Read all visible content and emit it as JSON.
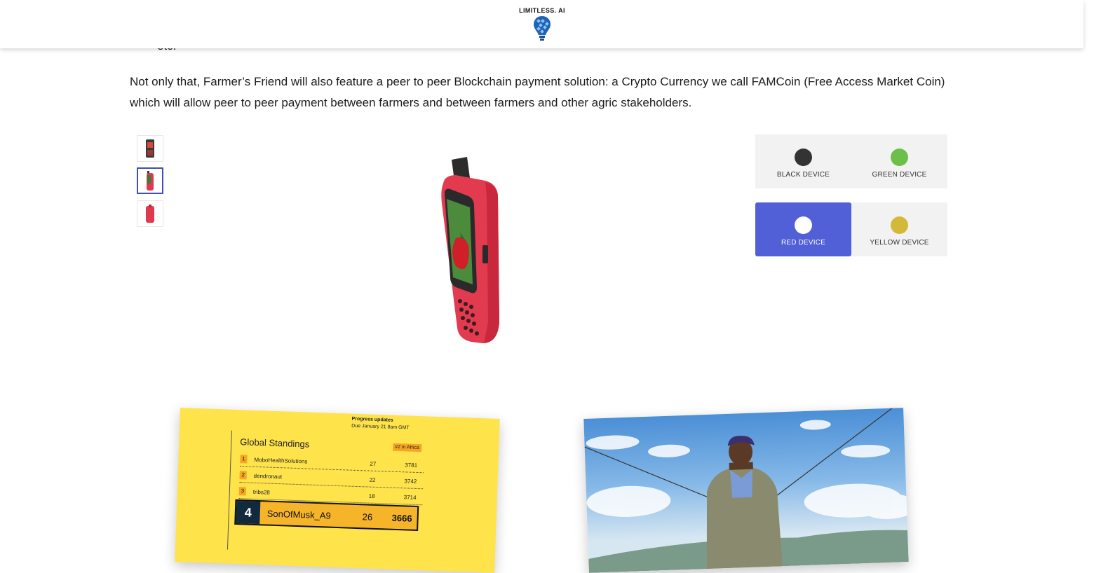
{
  "header": {
    "logo_text": "LIMITLESS. AI"
  },
  "content": {
    "bullet_item": "etc.",
    "paragraph": "Not only that, Farmer’s Friend will also feature a peer to peer Blockchain payment solution: a Crypto Currency we call FAMCoin (Free Access Market Coin) which will allow peer to peer payment between farmers and between farmers and other agric stakeholders."
  },
  "gallery": {
    "thumbnails": [
      {
        "name": "black-device-thumbnail",
        "color": "#3a3a3a",
        "active": false
      },
      {
        "name": "red-device-side-thumbnail",
        "color": "#e0394f",
        "active": true
      },
      {
        "name": "red-device-back-thumbnail",
        "color": "#e0394f",
        "active": false
      }
    ],
    "main_image": "red-device"
  },
  "color_options": [
    {
      "label": "BLACK DEVICE",
      "color": "#333333",
      "selected": false
    },
    {
      "label": "GREEN DEVICE",
      "color": "#6cc04a",
      "selected": false
    },
    {
      "label": "RED DEVICE",
      "color": "#ffffff",
      "selected": true
    },
    {
      "label": "YELLOW DEVICE",
      "color": "#d4b83a",
      "selected": false
    }
  ],
  "standings_card": {
    "progress_title": "Progress updates",
    "progress_due": "Due January 21 8am GMT",
    "title": "Global Standings",
    "badge": "#2 in Africa",
    "rows": [
      {
        "rank": "1",
        "name": "MoboHealthSolutions",
        "score": "27",
        "points": "3781"
      },
      {
        "rank": "2",
        "name": "dendronaut",
        "score": "22",
        "points": "3742"
      },
      {
        "rank": "3",
        "name": "tribs28",
        "score": "18",
        "points": "3714"
      }
    ],
    "highlight": {
      "rank": "4",
      "name": "SonOfMusk_A9",
      "score": "26",
      "points": "3666"
    }
  },
  "accent_color": "#5160d6"
}
